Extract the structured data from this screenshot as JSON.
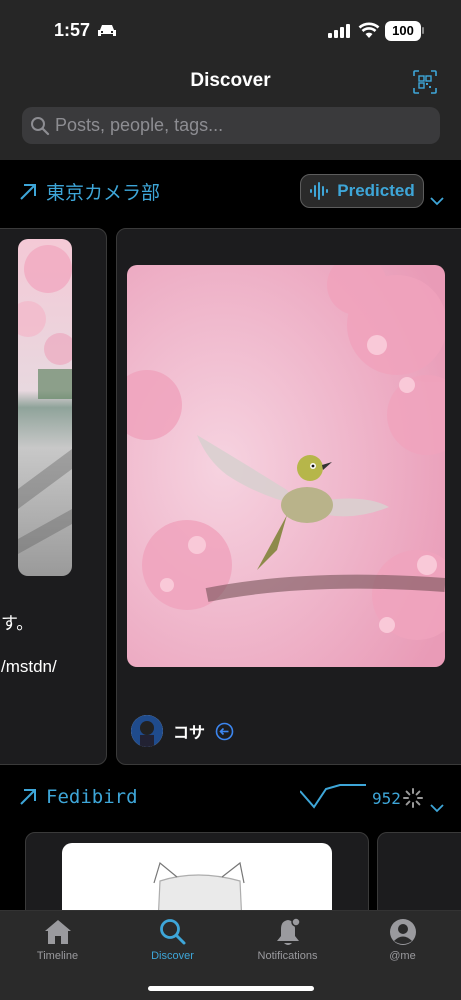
{
  "status_bar": {
    "time": "1:57",
    "battery": "100"
  },
  "header": {
    "title": "Discover"
  },
  "search": {
    "placeholder": "Posts, people, tags..."
  },
  "sections": [
    {
      "title": "東京カメラ部",
      "badge_label": "Predicted",
      "left_card_snippets": [
        "す。",
        "/mstdn/"
      ],
      "main_card": {
        "author": "コサ"
      }
    },
    {
      "title": "Fedibird",
      "count": "952"
    }
  ],
  "tabs": [
    {
      "label": "Timeline",
      "icon": "home-icon"
    },
    {
      "label": "Discover",
      "icon": "search-icon",
      "active": true
    },
    {
      "label": "Notifications",
      "icon": "bell-icon"
    },
    {
      "label": "@me",
      "icon": "person-icon"
    }
  ],
  "colors": {
    "accent": "#3ea6d8",
    "background": "#000000",
    "chrome": "#262626"
  }
}
